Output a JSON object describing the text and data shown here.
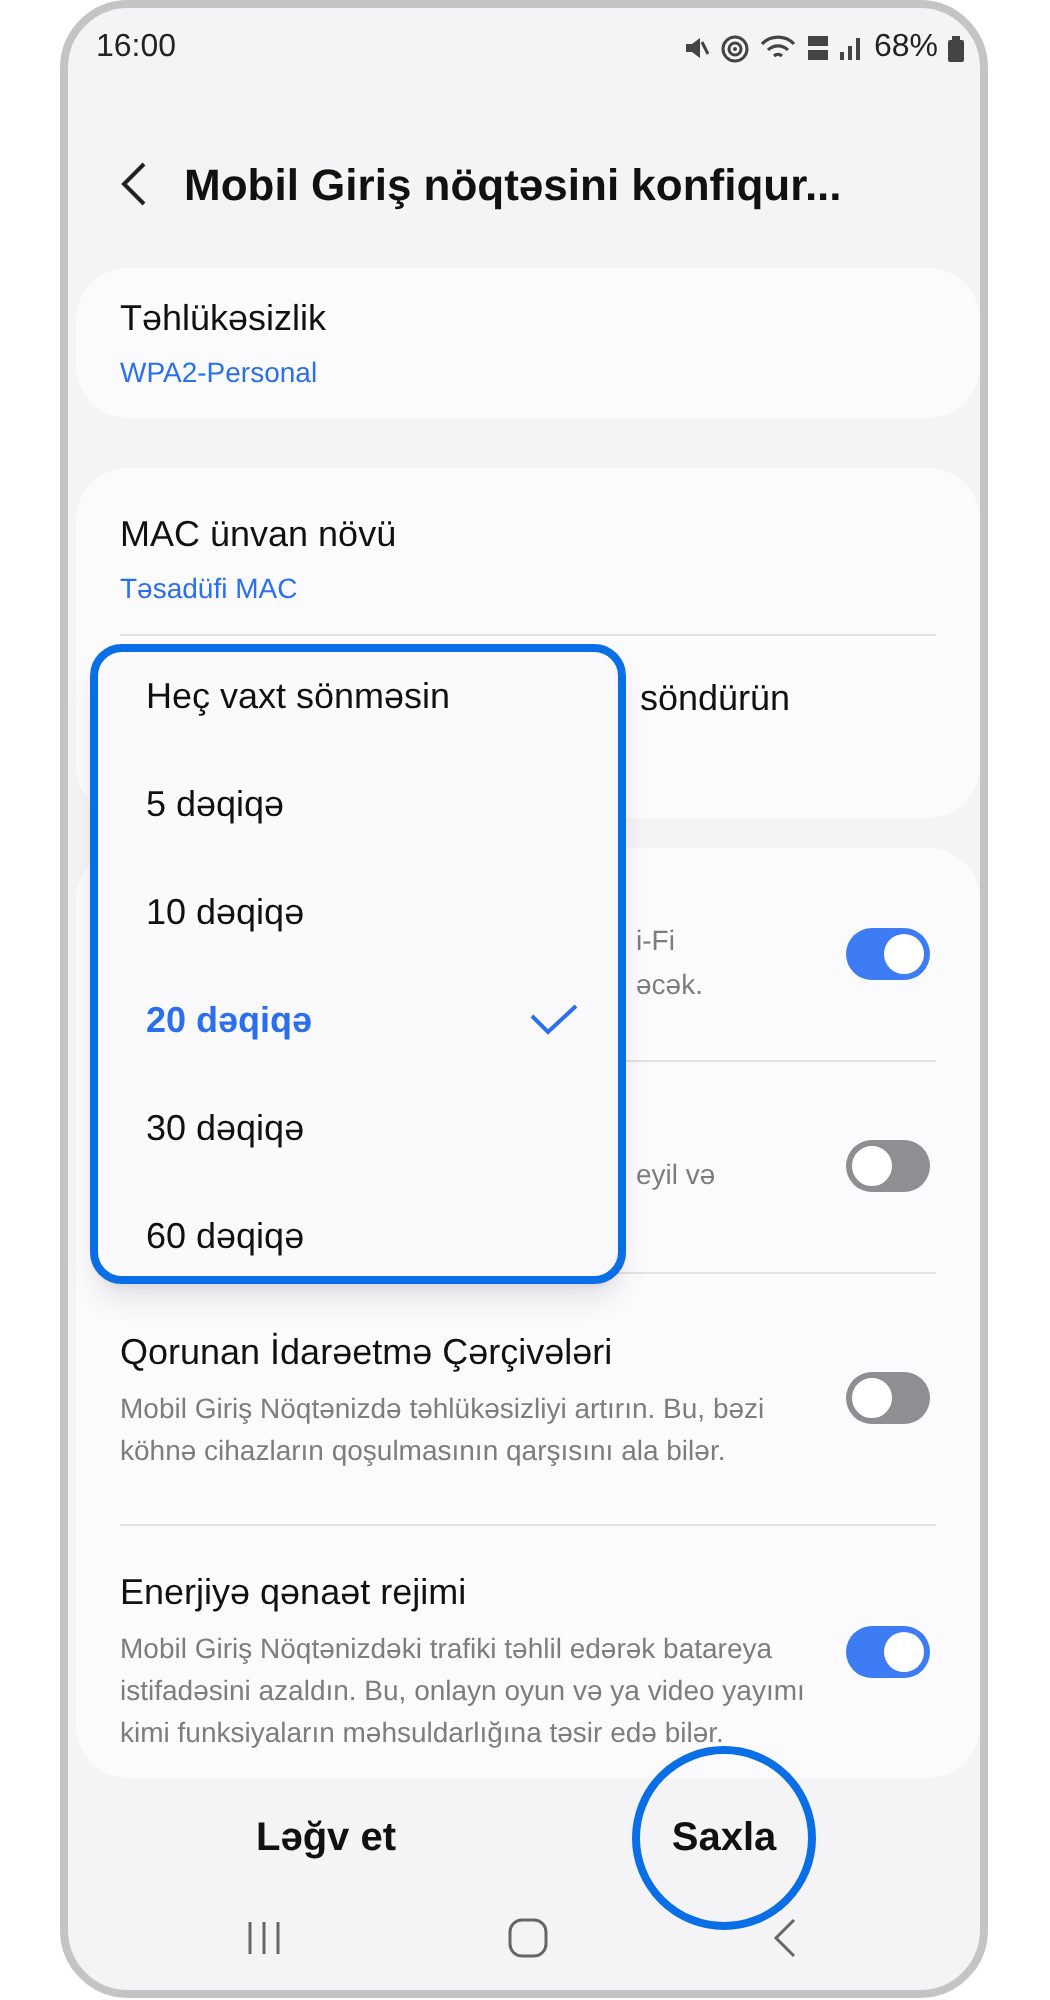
{
  "status_bar": {
    "time": "16:00",
    "battery": "68%"
  },
  "header": {
    "title": "Mobil Giriş nöqtəsini konfiqur..."
  },
  "security": {
    "title": "Təhlükəsizlik",
    "value": "WPA2-Personal"
  },
  "mac": {
    "title": "MAC ünvan növü",
    "value": "Təsadüfi MAC"
  },
  "timeout_row": {
    "title": "söndürün"
  },
  "settings": [
    {
      "fragments": [
        "i-Fi",
        "əcək."
      ],
      "on": true
    },
    {
      "fragments": [
        "eyil və"
      ],
      "on": false
    },
    {
      "title": "Qorunan İdarəetmə Çərçivələri",
      "description": "Mobil Giriş Nöqtənizdə təhlükəsizliyi artırın. Bu, bəzi köhnə cihazların qoşulmasının qarşısını ala bilər.",
      "on": false
    },
    {
      "title": "Enerjiyə qənaət rejimi",
      "description": "Mobil Giriş Nöqtənizdəki trafiki təhlil edərək batareya istifadəsini azaldın. Bu, onlayn oyun və ya video yayımı kimi funksiyaların məhsuldarlığına təsir edə bilər.",
      "on": true
    }
  ],
  "dropdown": {
    "highlighted": true,
    "options": [
      {
        "label": "Heç vaxt sönməsin",
        "selected": false
      },
      {
        "label": "5 dəqiqə",
        "selected": false
      },
      {
        "label": "10 dəqiqə",
        "selected": false
      },
      {
        "label": "20 dəqiqə",
        "selected": true
      },
      {
        "label": "30 dəqiqə",
        "selected": false
      },
      {
        "label": "60 dəqiqə",
        "selected": false
      }
    ]
  },
  "buttons": [
    {
      "label": "Ləğv et",
      "highlighted": false
    },
    {
      "label": "Saxla",
      "highlighted": true
    }
  ]
}
